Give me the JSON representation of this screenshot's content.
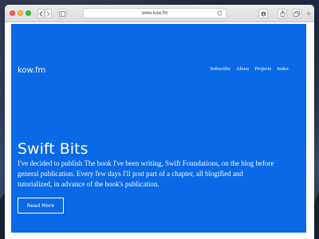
{
  "browser": {
    "url": "www.kow.fm"
  },
  "site": {
    "title": "kow.fm",
    "nav": [
      "Subscribe",
      "About",
      "Projects",
      "Index"
    ]
  },
  "hero": {
    "title": "Swift Bits",
    "body": "I've decided to publish The book I've been writing, Swift Foundations, on the blog before general publication. Every few days I'll post part of a chapter, all blogified and tutorialized, in advance of the book's publication.",
    "button_label": "Read More"
  },
  "colors": {
    "page_background": "#0a69e6",
    "text": "#ffffff"
  }
}
